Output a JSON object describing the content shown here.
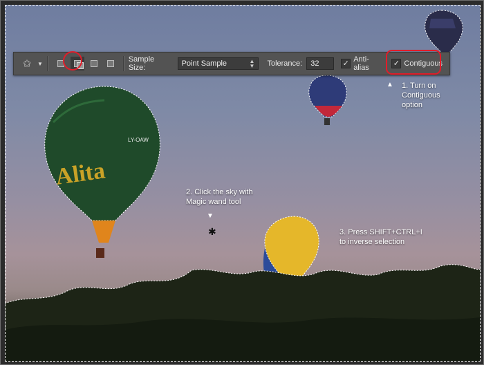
{
  "toolbar": {
    "tool_icon": "magic-wand-icon",
    "selection_modes": [
      "new-selection-icon",
      "add-to-selection-icon",
      "subtract-from-selection-icon",
      "intersect-selection-icon"
    ],
    "sample_size_label": "Sample Size:",
    "sample_size_value": "Point Sample",
    "tolerance_label": "Tolerance:",
    "tolerance_value": "32",
    "anti_alias_label": "Anti-alias",
    "contiguous_label": "Contiguous",
    "anti_alias_checked": true,
    "contiguous_checked": true
  },
  "notes": {
    "step1": "1. Turn on\nContiguous\noption",
    "step2": "2. Click the sky with\nMagic wand tool",
    "step3": "3. Press SHIFT+CTRL+I\nto inverse selection"
  },
  "balloons": {
    "large_text": "Alita",
    "registration": "LY-OAW"
  },
  "colors": {
    "highlight_ring": "#e11d2a",
    "toolbar_bg": "#535353"
  }
}
